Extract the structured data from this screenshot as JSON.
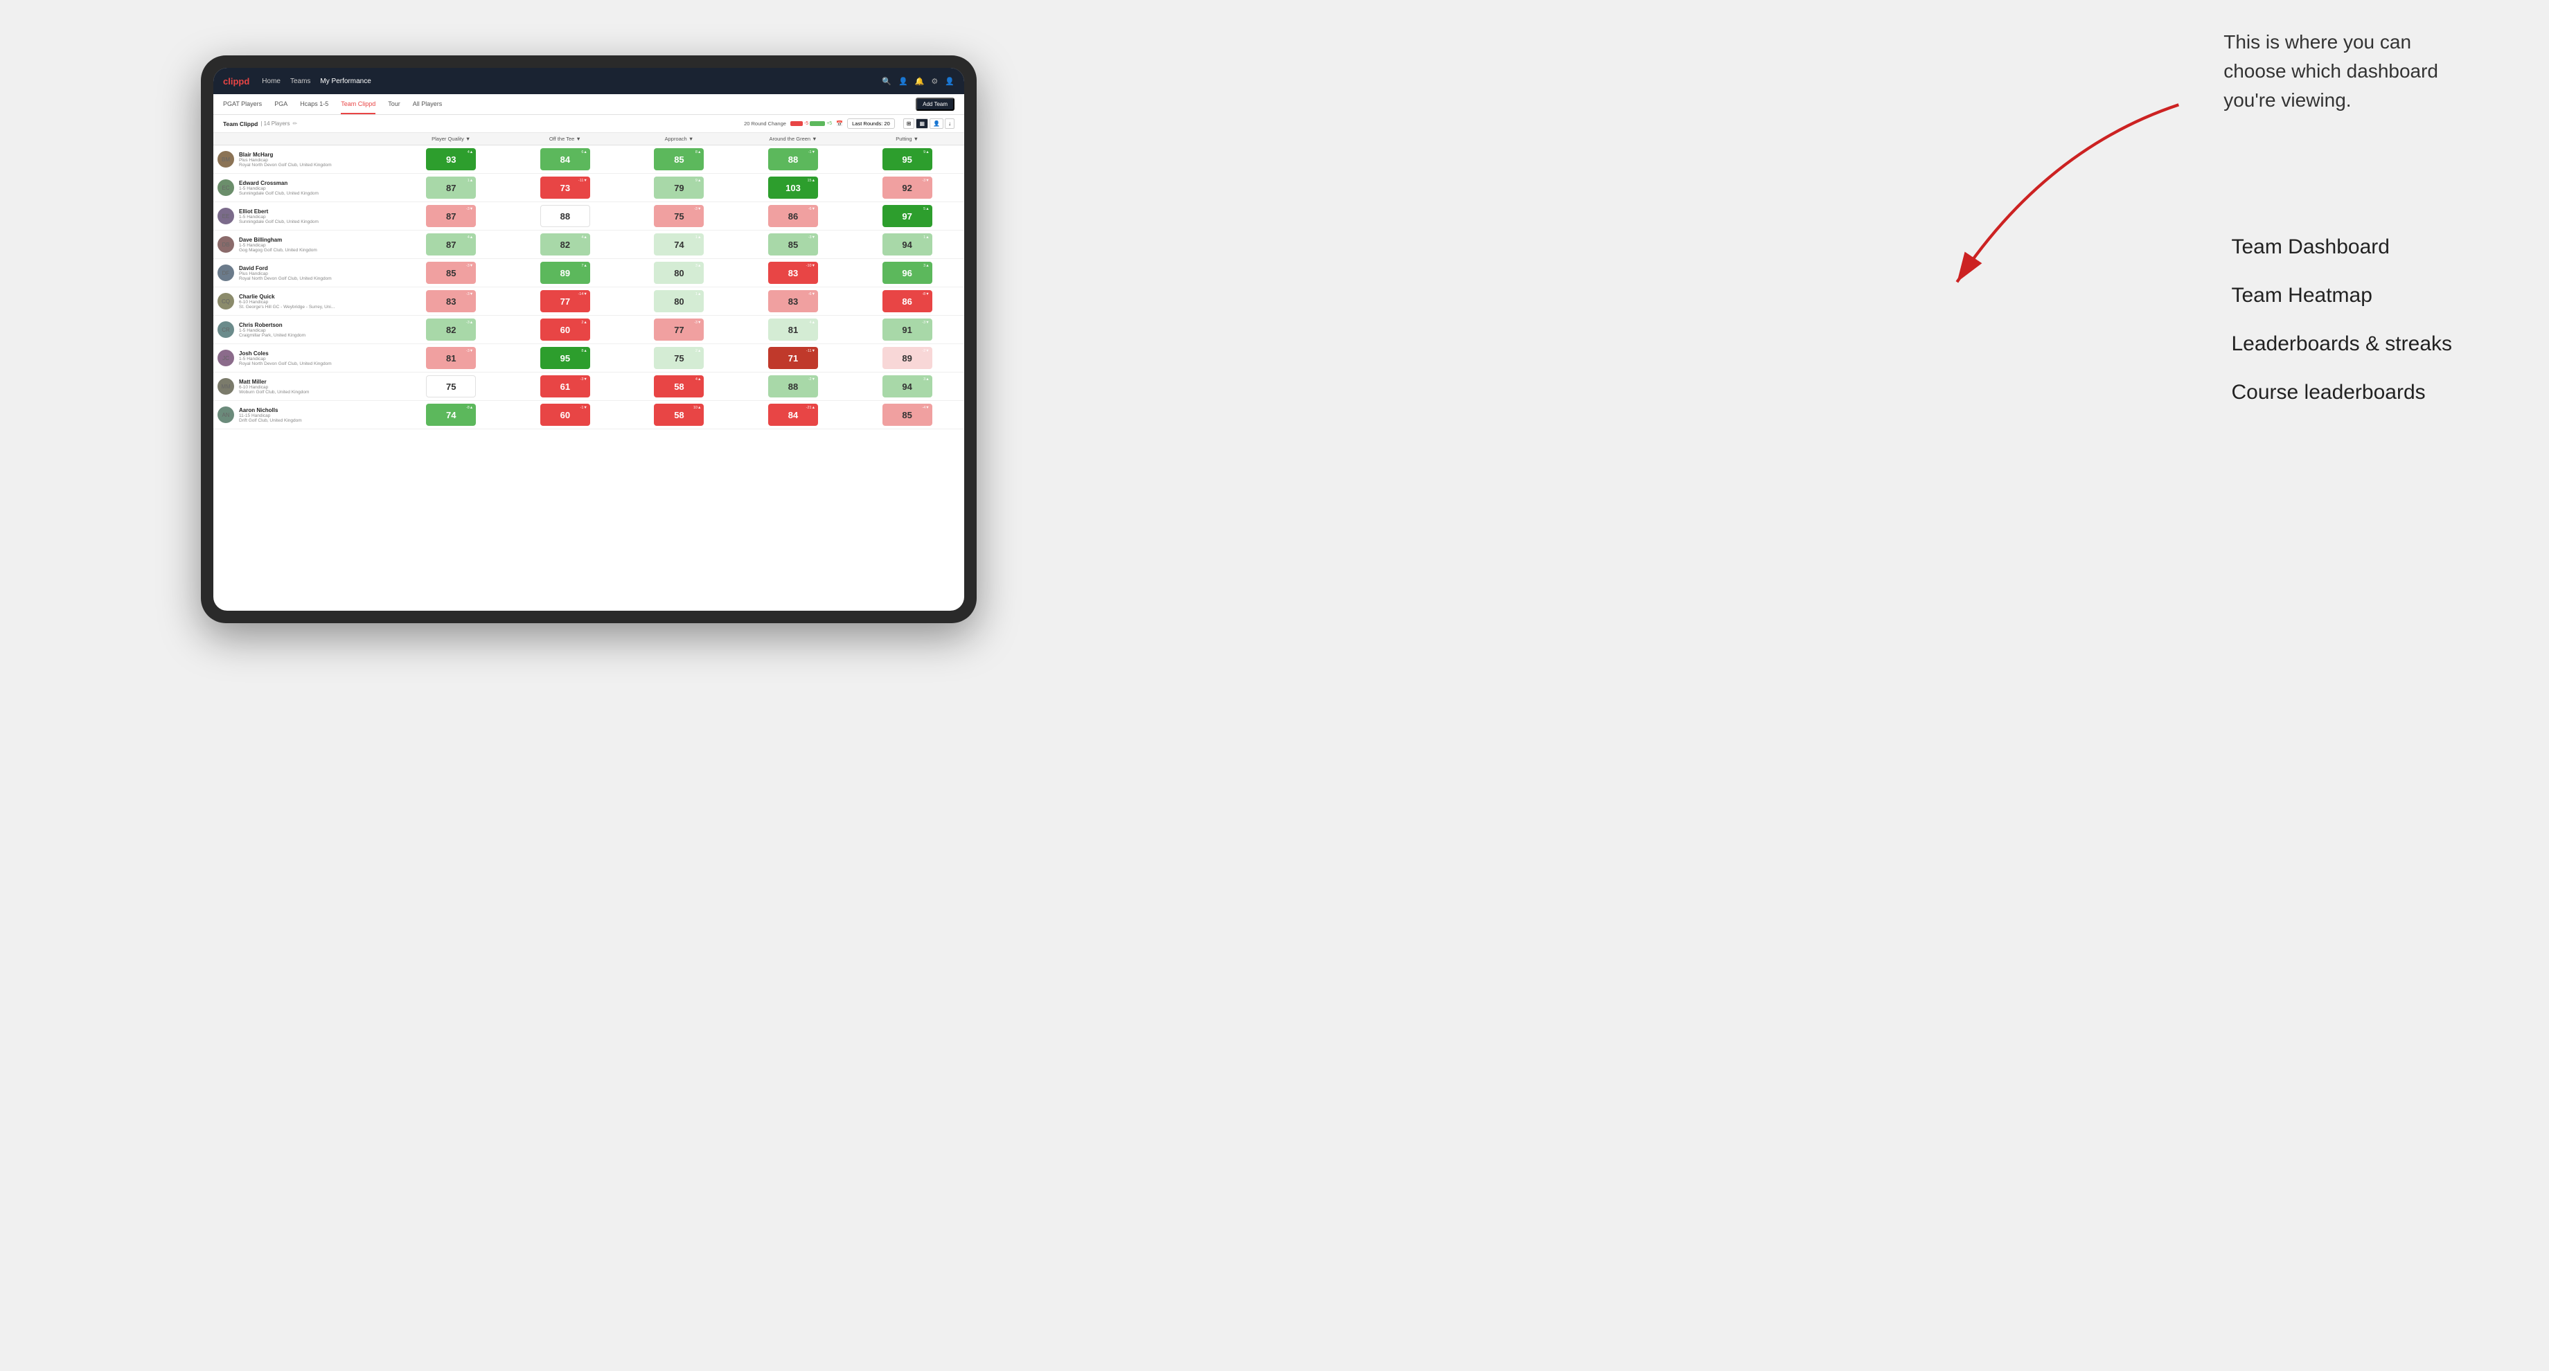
{
  "annotation": {
    "line1": "This is where you can",
    "line2": "choose which dashboard",
    "line3": "you're viewing."
  },
  "dashboard_labels": [
    "Team Dashboard",
    "Team Heatmap",
    "Leaderboards & streaks",
    "Course leaderboards"
  ],
  "nav": {
    "logo": "clippd",
    "links": [
      "Home",
      "Teams",
      "My Performance"
    ],
    "active": "My Performance"
  },
  "sub_nav": {
    "links": [
      "PGAT Players",
      "PGA",
      "Hcaps 1-5",
      "Team Clippd",
      "Tour",
      "All Players"
    ],
    "active": "Team Clippd",
    "add_team_label": "Add Team"
  },
  "team_header": {
    "name": "Team Clippd",
    "separator": "|",
    "count": "14 Players",
    "round_change_label": "20 Round Change",
    "neg_value": "-5",
    "pos_value": "+5",
    "last_rounds_label": "Last Rounds: 20"
  },
  "table": {
    "columns": [
      "Player Quality ▼",
      "Off the Tee ▼",
      "Approach ▼",
      "Around the Green ▼",
      "Putting ▼"
    ],
    "players": [
      {
        "name": "Blair McHarg",
        "handicap": "Plus Handicap",
        "club": "Royal North Devon Golf Club, United Kingdom",
        "scores": [
          {
            "value": "93",
            "change": "4▲",
            "color": "dark-green"
          },
          {
            "value": "84",
            "change": "6▲",
            "color": "med-green"
          },
          {
            "value": "85",
            "change": "8▲",
            "color": "med-green"
          },
          {
            "value": "88",
            "change": "-1▼",
            "color": "med-green"
          },
          {
            "value": "95",
            "change": "9▲",
            "color": "dark-green"
          }
        ]
      },
      {
        "name": "Edward Crossman",
        "handicap": "1-5 Handicap",
        "club": "Sunningdale Golf Club, United Kingdom",
        "scores": [
          {
            "value": "87",
            "change": "1▲",
            "color": "light-green"
          },
          {
            "value": "73",
            "change": "-11▼",
            "color": "med-red"
          },
          {
            "value": "79",
            "change": "9▲",
            "color": "light-green"
          },
          {
            "value": "103",
            "change": "15▲",
            "color": "dark-green"
          },
          {
            "value": "92",
            "change": "-3▼",
            "color": "light-red"
          }
        ]
      },
      {
        "name": "Elliot Ebert",
        "handicap": "1-5 Handicap",
        "club": "Sunningdale Golf Club, United Kingdom",
        "scores": [
          {
            "value": "87",
            "change": "-3▼",
            "color": "light-red"
          },
          {
            "value": "88",
            "change": "",
            "color": "white-bg"
          },
          {
            "value": "75",
            "change": "-3▼",
            "color": "light-red"
          },
          {
            "value": "86",
            "change": "-6▼",
            "color": "light-red"
          },
          {
            "value": "97",
            "change": "5▲",
            "color": "dark-green"
          }
        ]
      },
      {
        "name": "Dave Billingham",
        "handicap": "1-5 Handicap",
        "club": "Gog Magog Golf Club, United Kingdom",
        "scores": [
          {
            "value": "87",
            "change": "4▲",
            "color": "light-green"
          },
          {
            "value": "82",
            "change": "4▲",
            "color": "light-green"
          },
          {
            "value": "74",
            "change": "1▲",
            "color": "very-light-green"
          },
          {
            "value": "85",
            "change": "-3▼",
            "color": "light-green"
          },
          {
            "value": "94",
            "change": "1▲",
            "color": "light-green"
          }
        ]
      },
      {
        "name": "David Ford",
        "handicap": "Plus Handicap",
        "club": "Royal North Devon Golf Club, United Kingdom",
        "scores": [
          {
            "value": "85",
            "change": "-3▼",
            "color": "light-red"
          },
          {
            "value": "89",
            "change": "7▲",
            "color": "med-green"
          },
          {
            "value": "80",
            "change": "3▲",
            "color": "very-light-green"
          },
          {
            "value": "83",
            "change": "-10▼",
            "color": "med-red"
          },
          {
            "value": "96",
            "change": "3▲",
            "color": "med-green"
          }
        ]
      },
      {
        "name": "Charlie Quick",
        "handicap": "6-10 Handicap",
        "club": "St. George's Hill GC - Weybridge - Surrey, Uni...",
        "scores": [
          {
            "value": "83",
            "change": "-3▼",
            "color": "light-red"
          },
          {
            "value": "77",
            "change": "-14▼",
            "color": "med-red"
          },
          {
            "value": "80",
            "change": "1▲",
            "color": "very-light-green"
          },
          {
            "value": "83",
            "change": "-6▼",
            "color": "light-red"
          },
          {
            "value": "86",
            "change": "-8▼",
            "color": "med-red"
          }
        ]
      },
      {
        "name": "Chris Robertson",
        "handicap": "1-5 Handicap",
        "club": "Craigmillar Park, United Kingdom",
        "scores": [
          {
            "value": "82",
            "change": "-3▲",
            "color": "light-green"
          },
          {
            "value": "60",
            "change": "2▲",
            "color": "med-red"
          },
          {
            "value": "77",
            "change": "-3▼",
            "color": "light-red"
          },
          {
            "value": "81",
            "change": "4▲",
            "color": "very-light-green"
          },
          {
            "value": "91",
            "change": "-3▼",
            "color": "light-green"
          }
        ]
      },
      {
        "name": "Josh Coles",
        "handicap": "1-5 Handicap",
        "club": "Royal North Devon Golf Club, United Kingdom",
        "scores": [
          {
            "value": "81",
            "change": "-3▼",
            "color": "light-red"
          },
          {
            "value": "95",
            "change": "8▲",
            "color": "dark-green"
          },
          {
            "value": "75",
            "change": "2▲",
            "color": "very-light-green"
          },
          {
            "value": "71",
            "change": "-11▼",
            "color": "dark-red"
          },
          {
            "value": "89",
            "change": "-2▼",
            "color": "very-light-red"
          }
        ]
      },
      {
        "name": "Matt Miller",
        "handicap": "6-10 Handicap",
        "club": "Woburn Golf Club, United Kingdom",
        "scores": [
          {
            "value": "75",
            "change": "",
            "color": "white-bg"
          },
          {
            "value": "61",
            "change": "-3▼",
            "color": "med-red"
          },
          {
            "value": "58",
            "change": "4▲",
            "color": "med-red"
          },
          {
            "value": "88",
            "change": "-2▼",
            "color": "light-green"
          },
          {
            "value": "94",
            "change": "3▲",
            "color": "light-green"
          }
        ]
      },
      {
        "name": "Aaron Nicholls",
        "handicap": "11-15 Handicap",
        "club": "Drift Golf Club, United Kingdom",
        "scores": [
          {
            "value": "74",
            "change": "-8▲",
            "color": "med-green"
          },
          {
            "value": "60",
            "change": "-1▼",
            "color": "med-red"
          },
          {
            "value": "58",
            "change": "10▲",
            "color": "med-red"
          },
          {
            "value": "84",
            "change": "-21▲",
            "color": "med-red"
          },
          {
            "value": "85",
            "change": "-4▼",
            "color": "light-red"
          }
        ]
      }
    ]
  }
}
